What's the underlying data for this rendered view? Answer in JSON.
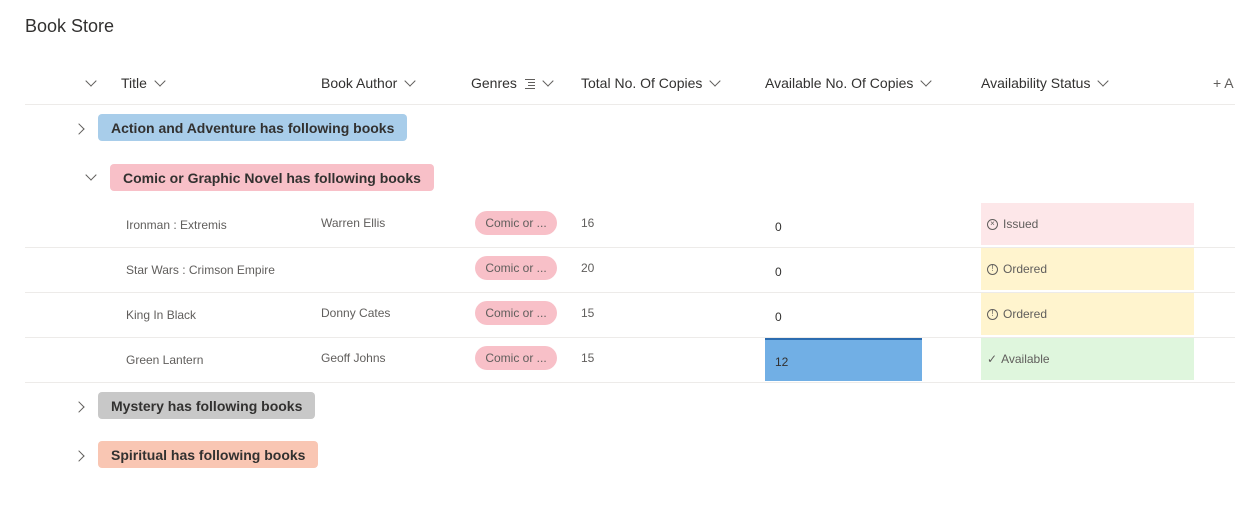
{
  "page_title": "Book Store",
  "columns": [
    {
      "label": "Title"
    },
    {
      "label": "Book Author"
    },
    {
      "label": "Genres"
    },
    {
      "label": "Total No. Of Copies"
    },
    {
      "label": "Available No. Of Copies"
    },
    {
      "label": "Availability Status"
    }
  ],
  "add_column_label": "+ A",
  "groups": [
    {
      "label": "Action and Adventure has following books",
      "color": "#a8cdea"
    },
    {
      "label": "Comic or Graphic Novel has following books",
      "color": "#f8c0c8"
    },
    {
      "label": "Mystery has following books",
      "color": "#c8c8c8"
    },
    {
      "label": "Spiritual has following books",
      "color": "#f9c6b3"
    }
  ],
  "rows": [
    {
      "title": "Ironman : Extremis",
      "author": "Warren Ellis",
      "genre": "Comic or ...",
      "total": "16",
      "available": "0",
      "status": "Issued",
      "status_color": "#fde7e9",
      "status_icon": "circle-x-icon"
    },
    {
      "title": "Star Wars : Crimson Empire",
      "author": "",
      "genre": "Comic or ...",
      "total": "20",
      "available": "0",
      "status": "Ordered",
      "status_color": "#fff4ce",
      "status_icon": "info-circle-icon"
    },
    {
      "title": "King In Black",
      "author": "Donny Cates",
      "genre": "Comic or ...",
      "total": "15",
      "available": "0",
      "status": "Ordered",
      "status_color": "#fff4ce",
      "status_icon": "info-circle-icon"
    },
    {
      "title": "Green Lantern",
      "author": "Geoff Johns",
      "genre": "Comic or ...",
      "total": "15",
      "available": "12",
      "status": "Available",
      "status_color": "#dff6dd",
      "status_icon": "check-icon"
    }
  ]
}
